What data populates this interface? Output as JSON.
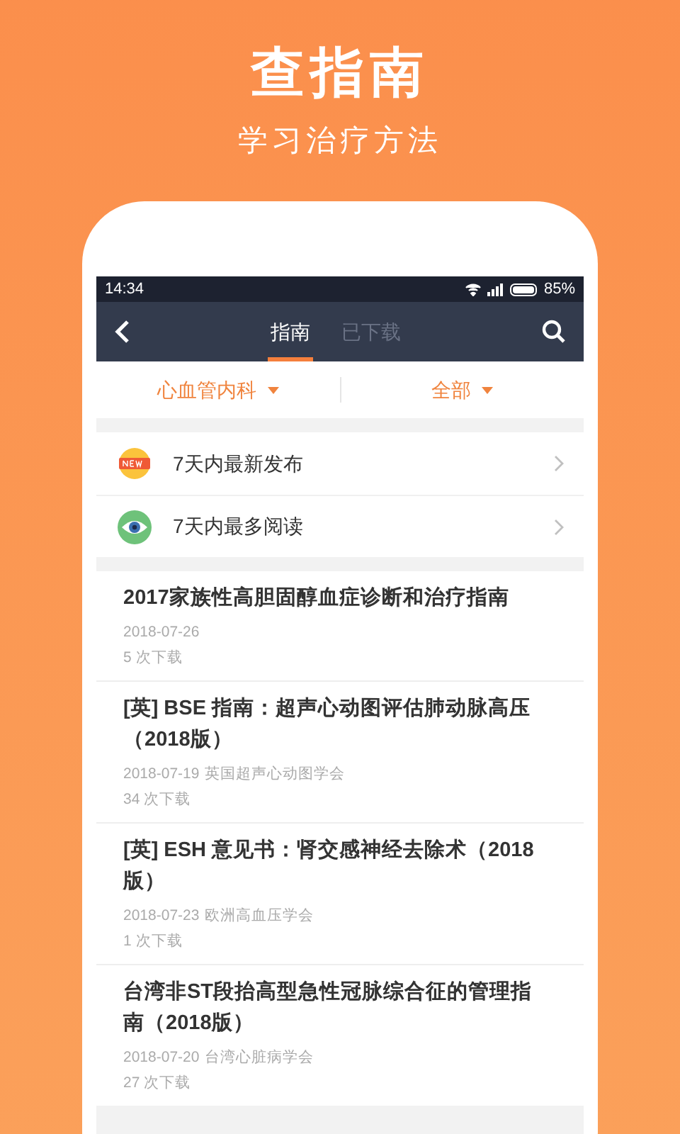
{
  "headline": "查指南",
  "subheadline": "学习治疗方法",
  "status_bar": {
    "time": "14:34",
    "battery": "85%"
  },
  "tabs": [
    {
      "label": "指南",
      "selected": true
    },
    {
      "label": "已下载",
      "selected": false
    }
  ],
  "filters": [
    "心血管内科",
    "全部"
  ],
  "shortcuts": [
    {
      "kind": "new",
      "label": "7天内最新发布"
    },
    {
      "kind": "eye",
      "label": "7天内最多阅读"
    }
  ],
  "guidelines": [
    {
      "title": "2017家族性高胆固醇血症诊断和治疗指南",
      "date": "2018-07-26",
      "downloads": "5 次下载"
    },
    {
      "title": "[英] BSE 指南：超声心动图评估肺动脉高压（2018版）",
      "date": "2018-07-19",
      "source": "英国超声心动图学会",
      "downloads": "34 次下载"
    },
    {
      "title": "[英] ESH 意见书：肾交感神经去除术（2018版）",
      "date": "2018-07-23",
      "source": "欧洲高血压学会",
      "downloads": "1 次下载"
    },
    {
      "title": "台湾非ST段抬高型急性冠脉综合征的管理指南（2018版）",
      "date": "2018-07-20",
      "source": "台湾心脏病学会",
      "downloads": "27 次下载"
    }
  ]
}
